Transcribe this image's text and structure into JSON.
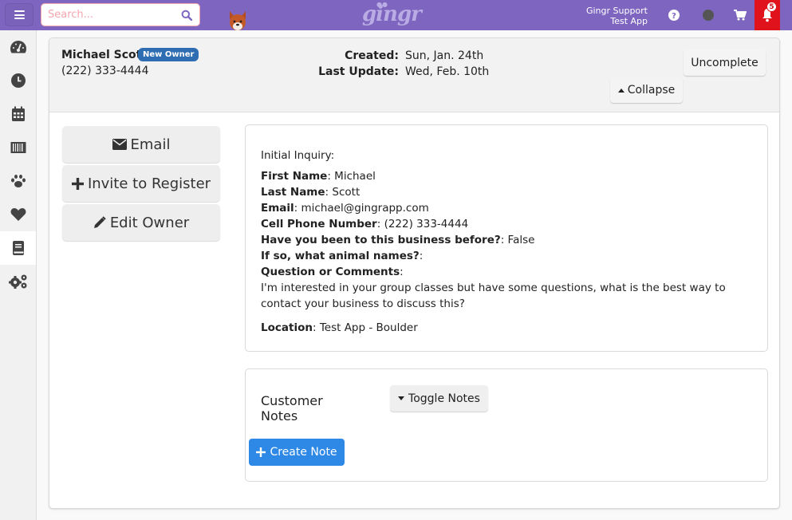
{
  "topbar": {
    "search_placeholder": "Search...",
    "logo_text": "gingr",
    "user_name": "Gingr Support",
    "user_app": "Test App",
    "notification_count": "5",
    "colors": {
      "nav_bg": "#7e66c0",
      "alert_bg": "#e0121c"
    }
  },
  "sidebar": {
    "items": [
      {
        "icon": "dashboard-icon",
        "active": false
      },
      {
        "icon": "clock-icon",
        "active": false
      },
      {
        "icon": "calendar-icon",
        "active": false
      },
      {
        "icon": "barcode-icon",
        "active": false
      },
      {
        "icon": "paw-icon",
        "active": false
      },
      {
        "icon": "heart-icon",
        "active": false
      },
      {
        "icon": "book-icon",
        "active": true
      },
      {
        "icon": "gears-icon",
        "active": false
      }
    ]
  },
  "owner": {
    "name": "Michael Scott",
    "badge": "New Owner",
    "phone": "(222) 333-4444",
    "created_label": "Created:",
    "created_value": "Sun, Jan. 24th",
    "updated_label": "Last Update:",
    "updated_value": "Wed, Feb. 10th"
  },
  "header_buttons": {
    "uncomplete": "Uncomplete",
    "collapse": "Collapse"
  },
  "actions": {
    "email": "Email",
    "invite": "Invite to Register",
    "edit": "Edit Owner"
  },
  "inquiry": {
    "title": "Initial Inquiry:",
    "fields": [
      {
        "label": "First Name",
        "value": " Michael"
      },
      {
        "label": "Last Name",
        "value": " Scott"
      },
      {
        "label": "Email",
        "value": " michael@gingrapp.com"
      },
      {
        "label": "Cell Phone Number",
        "value": " (222) 333-4444"
      },
      {
        "label": "Have you been to this business before?",
        "value": " False"
      },
      {
        "label": "If so, what animal names?",
        "value": ""
      },
      {
        "label": "Question or Comments",
        "value": ""
      }
    ],
    "comment": "I'm interested in your group classes but have some questions, what is the best way to contact your business to discuss this?",
    "location_label": "Location",
    "location_value": " Test App - Boulder"
  },
  "notes": {
    "title": "Customer Notes",
    "toggle": "Toggle Notes",
    "create": "Create Note",
    "colors": {
      "create_bg": "#2d88e6",
      "badge_bg": "#2e6db2"
    }
  }
}
